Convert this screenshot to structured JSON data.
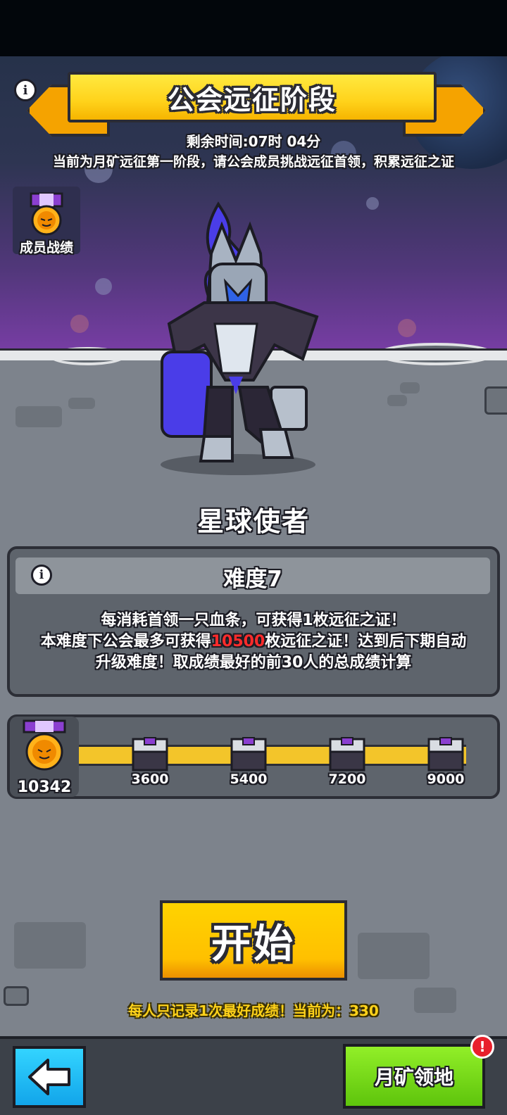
{
  "header": {
    "title": "公会远征阶段",
    "timer": "剩余时间:07时 04分",
    "description": "当前为月矿远征第一阶段，请公会成员挑战远征首领，积累远征之证"
  },
  "member_record": {
    "label": "成员战绩"
  },
  "boss": {
    "name": "星球使者"
  },
  "difficulty": {
    "title": "难度7",
    "line1": "每消耗首领一只血条，可获得1枚远征之证！",
    "line2_pre": "本难度下公会最多可获得",
    "line2_highlight": "10500",
    "line2_post": "枚远征之证！达到后下期自动",
    "line3": "升级难度！取成绩最好的前30人的总成绩计算",
    "highlight_color": "#ff2b2b"
  },
  "progress": {
    "current": "10342",
    "milestones": [
      "3600",
      "5400",
      "7200",
      "9000"
    ]
  },
  "start_button": {
    "label": "开始"
  },
  "record_note": "每人只记录1次最好成绩！当前为：330",
  "nav": {
    "back_icon": "back-arrow-icon",
    "moon_button": "月矿领地",
    "badge": "!"
  }
}
